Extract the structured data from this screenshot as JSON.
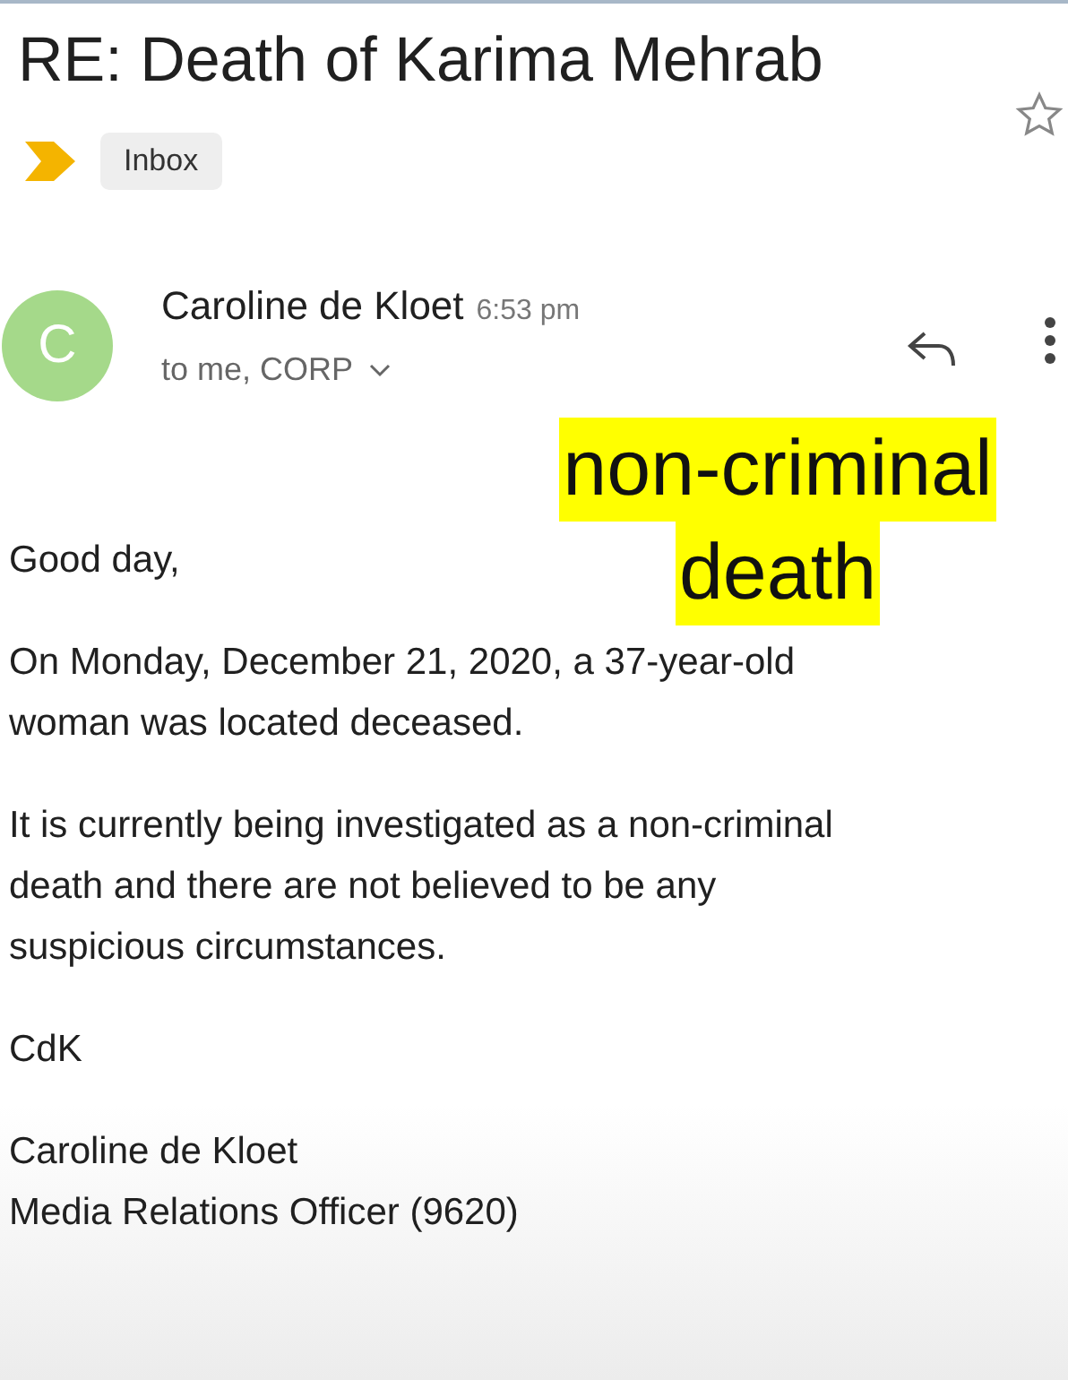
{
  "subject": "RE: Death of Karima Mehrab",
  "starred": false,
  "label": "Inbox",
  "sender": {
    "initial": "C",
    "name": "Caroline de Kloet",
    "time": "6:53 pm",
    "recipients": "to me, CORP"
  },
  "body": [
    [
      "Good day,"
    ],
    [
      "On Monday, December 21, 2020, a 37-year-old",
      "woman was located deceased."
    ],
    [
      "It is currently being investigated as a non-criminal",
      "death and there are not believed to be any",
      "suspicious circumstances."
    ],
    [
      "CdK"
    ],
    [
      "Caroline de Kloet",
      "Media Relations Officer (9620)"
    ]
  ],
  "annotation": [
    "non-criminal",
    "death"
  ]
}
